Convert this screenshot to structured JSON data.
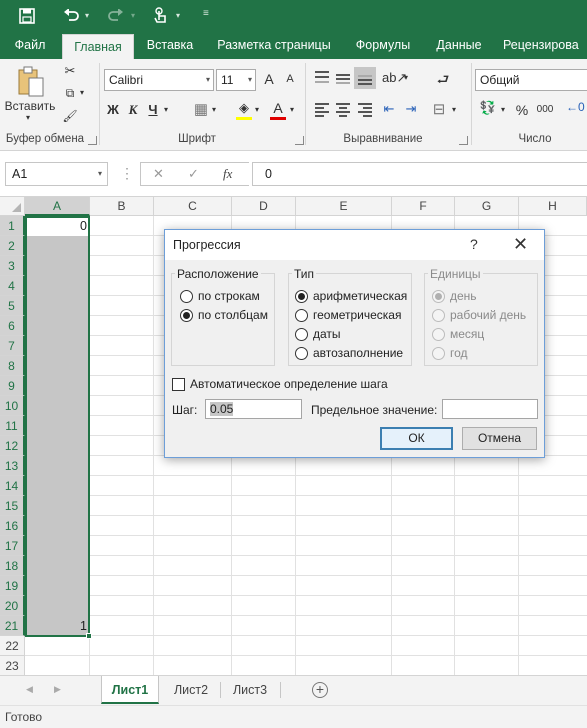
{
  "qat": {
    "save_icon": "save-icon",
    "undo_icon": "undo-icon",
    "redo_icon": "redo-icon",
    "touch_icon": "touch-mode-icon",
    "customize_icon": "customize-qat-icon"
  },
  "tabs": [
    "Файл",
    "Главная",
    "Вставка",
    "Разметка страницы",
    "Формулы",
    "Данные",
    "Рецензирова"
  ],
  "active_tab": "Главная",
  "ribbon": {
    "paste_label": "Вставить",
    "clipboard_group": "Буфер обмена",
    "font_name": "Calibri",
    "font_size": "11",
    "font_grow": "A",
    "font_shrink": "A",
    "bold": "Ж",
    "italic": "К",
    "underline": "Ч",
    "font_color_letter": "A",
    "font_group": "Шрифт",
    "alignment_group": "Выравнивание",
    "number_format": "Общий",
    "percent": "%",
    "thousands": "000",
    "number_group": "Число"
  },
  "formula_bar": {
    "name_box": "A1",
    "fx": "fx",
    "cancel": "✕",
    "enter": "✓",
    "value": "0"
  },
  "grid": {
    "columns": [
      "A",
      "B",
      "C",
      "D",
      "E",
      "F",
      "G",
      "H"
    ],
    "rows": [
      "1",
      "2",
      "3",
      "4",
      "5",
      "6",
      "7",
      "8",
      "9",
      "10",
      "11",
      "12",
      "13",
      "14",
      "15",
      "16",
      "17",
      "18",
      "19",
      "20",
      "21",
      "22",
      "23"
    ],
    "a1_value": "0",
    "a21_value": "1",
    "selected_range": "A1:A21"
  },
  "dialog": {
    "title": "Прогрессия",
    "help": "?",
    "close": "✕",
    "location_group": "Расположение",
    "location_options": [
      "по строкам",
      "по столбцам"
    ],
    "location_selected": "по столбцам",
    "type_group": "Тип",
    "type_options": [
      "арифметическая",
      "геометрическая",
      "даты",
      "автозаполнение"
    ],
    "type_selected": "арифметическая",
    "units_group": "Единицы",
    "units_options": [
      "день",
      "рабочий день",
      "месяц",
      "год"
    ],
    "units_selected": "день",
    "auto_step_label": "Автоматическое определение шага",
    "auto_step_checked": false,
    "step_label": "Шаг:",
    "step_value": "0.05",
    "limit_label": "Предельное значение:",
    "limit_value": "",
    "ok": "ОК",
    "cancel": "Отмена"
  },
  "sheets": [
    "Лист1",
    "Лист2",
    "Лист3"
  ],
  "active_sheet": "Лист1",
  "status": "Готово",
  "colors": {
    "excel_green": "#217346",
    "ribbon_bg": "#f3f3f3",
    "selection_fill": "#c6c6c6"
  }
}
